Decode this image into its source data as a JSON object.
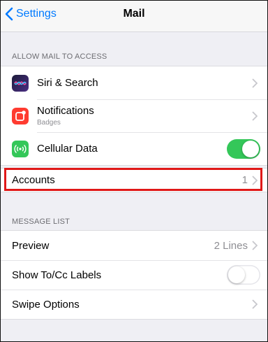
{
  "nav": {
    "back_label": "Settings",
    "title": "Mail"
  },
  "allow_section": {
    "header": "ALLOW MAIL TO ACCESS",
    "items": [
      {
        "label": "Siri & Search",
        "icon": "siri-icon"
      },
      {
        "label": "Notifications",
        "sublabel": "Badges",
        "icon": "notifications-icon"
      },
      {
        "label": "Cellular Data",
        "icon": "cellular-icon",
        "toggle": "on"
      }
    ]
  },
  "accounts": {
    "label": "Accounts",
    "value": "1"
  },
  "message_section": {
    "header": "MESSAGE LIST",
    "items": [
      {
        "label": "Preview",
        "value": "2 Lines"
      },
      {
        "label": "Show To/Cc Labels",
        "toggle": "off"
      },
      {
        "label": "Swipe Options"
      }
    ]
  },
  "colors": {
    "accent": "#007aff",
    "toggle_on": "#34c759",
    "highlight": "#e01818",
    "notifications_icon": "#ff3b30",
    "cellular_icon": "#34c759"
  }
}
